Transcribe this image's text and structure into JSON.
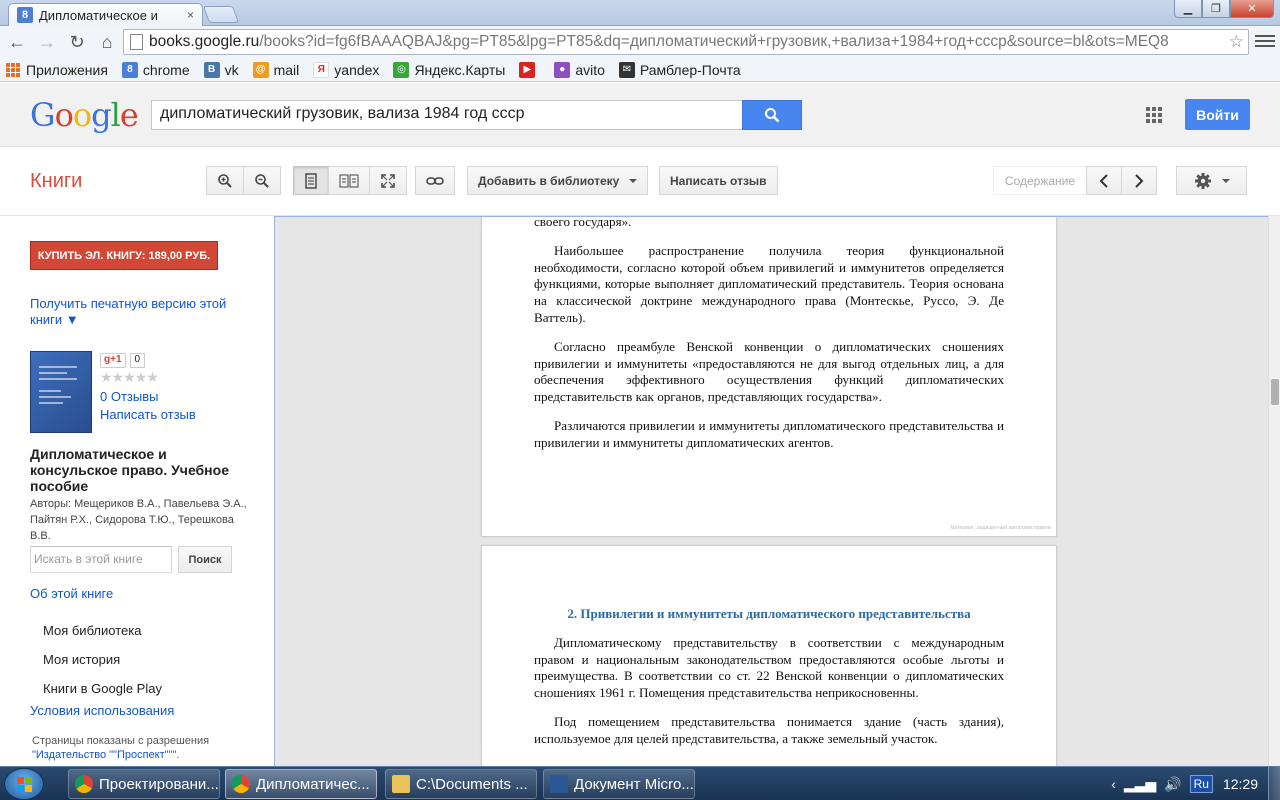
{
  "browser": {
    "tab_title": "Дипломатическое и",
    "tab_close": "×",
    "url_host": "books.google.ru",
    "url_path": "/books?id=fg6fBAAAQBAJ&pg=PT85&lpg=PT85&dq=дипломатический+грузовик,+вализа+1984+год+ссср&source=bl&ots=MEQ8",
    "bookmarks": [
      {
        "label": "Приложения",
        "icon": "apps-icon"
      },
      {
        "label": "chrome",
        "icon": "google-icon",
        "color": "#4a7fd4",
        "glyph": "8"
      },
      {
        "label": "vk",
        "icon": "vk-icon",
        "color": "#4a76a8",
        "glyph": "B"
      },
      {
        "label": "mail",
        "icon": "mail-at-icon",
        "color": "#f29a1d",
        "glyph": "@"
      },
      {
        "label": "yandex",
        "icon": "yandex-icon",
        "color": "#ffffff",
        "glyph": "Я"
      },
      {
        "label": "Яндекс.Карты",
        "icon": "yandex-maps-icon",
        "color": "#3aa53a",
        "glyph": "◎"
      },
      {
        "label": "",
        "icon": "youtube-icon",
        "color": "#d22",
        "glyph": "▶"
      },
      {
        "label": "avito",
        "icon": "avito-icon",
        "color": "#8d4fbf",
        "glyph": "●"
      },
      {
        "label": "Рамблер-Почта",
        "icon": "rambler-mail-icon",
        "color": "#333333",
        "glyph": "✉"
      }
    ]
  },
  "header": {
    "search_query": "дипломатический грузовик, вализа 1984 год ссср",
    "login_label": "Войти"
  },
  "subbar": {
    "section_title": "Книги",
    "add_library_label": "Добавить в библиотеку",
    "write_review_label": "Написать отзыв",
    "contents_label": "Содержание"
  },
  "sidebar": {
    "buy_label": "КУПИТЬ ЭЛ. КНИГУ: 189,00 РУБ.",
    "print_version_label": "Получить печатную версию этой книги ▼",
    "gplus_label": "g+1",
    "gplus_count": "0",
    "stars": "★★★★★",
    "reviews_link": "0 Отзывы",
    "write_review_link": "Написать отзыв",
    "book_title": "Дипломатическое и консульское право. Учебное пособие",
    "authors": "Авторы: Мещериков В.А., Павельева Э.А., Пайтян Р.Х., Сидорова Т.Ю., Терешкова В.В.",
    "search_placeholder": "Искать в этой книге",
    "search_button": "Поиск",
    "about_link": "Об этой книге",
    "menu_items": [
      "Моя библиотека",
      "Моя история",
      "Книги в Google Play"
    ],
    "terms_link": "Условия использования",
    "permission_text": "Страницы показаны с разрешения",
    "publisher_link": "\"Издательство \"\"Проспект\"\"\"."
  },
  "reader": {
    "page1": {
      "top_line": "своего государя».",
      "paragraphs": [
        "Наибольшее распространение получила теория функциональной необходимости, согласно которой объем привилегий и иммунитетов определяется функциями, которые выполняет дипломатический представитель. Теория основана на классической доктрине международного права (Монтескье, Руссо, Э. Де Ваттель).",
        "Согласно преамбуле Венской конвенции о дипломатических сношениях привилегии и иммунитеты «предоставляются не для выгод отдельных лиц, а для обеспечения эффективного осуществления функций дипломатических представительств как органов, представляющих государства».",
        "Различаются привилегии и иммунитеты дипломатического представительства и привилегии и иммунитеты дипломатических агентов."
      ],
      "watermark": "Материал, защищенный авторским правом"
    },
    "page2": {
      "chapter_title": "2. Привилегии и иммунитеты дипломатического представительства",
      "paragraphs": [
        "Дипломатическому представительству в соответствии с международным правом и национальным законодательством предоставляются особые льготы и преимущества. В соответствии со ст. 22 Венской конвенции о дипломатических сношениях 1961 г. Помещения представительства неприкосновенны.",
        "Под помещением представительства понимается здание (часть здания), используемое для целей представительства, а также земельный участок."
      ]
    }
  },
  "taskbar": {
    "tasks": [
      {
        "label": "Проектировани...",
        "icon": "chrome-icon"
      },
      {
        "label": "Дипломатичес...",
        "icon": "chrome-icon"
      },
      {
        "label": "C:\\Documents ...",
        "icon": "folder-icon"
      },
      {
        "label": "Документ Micro...",
        "icon": "word-icon"
      }
    ],
    "lang": "Ru",
    "clock": "12:29"
  }
}
